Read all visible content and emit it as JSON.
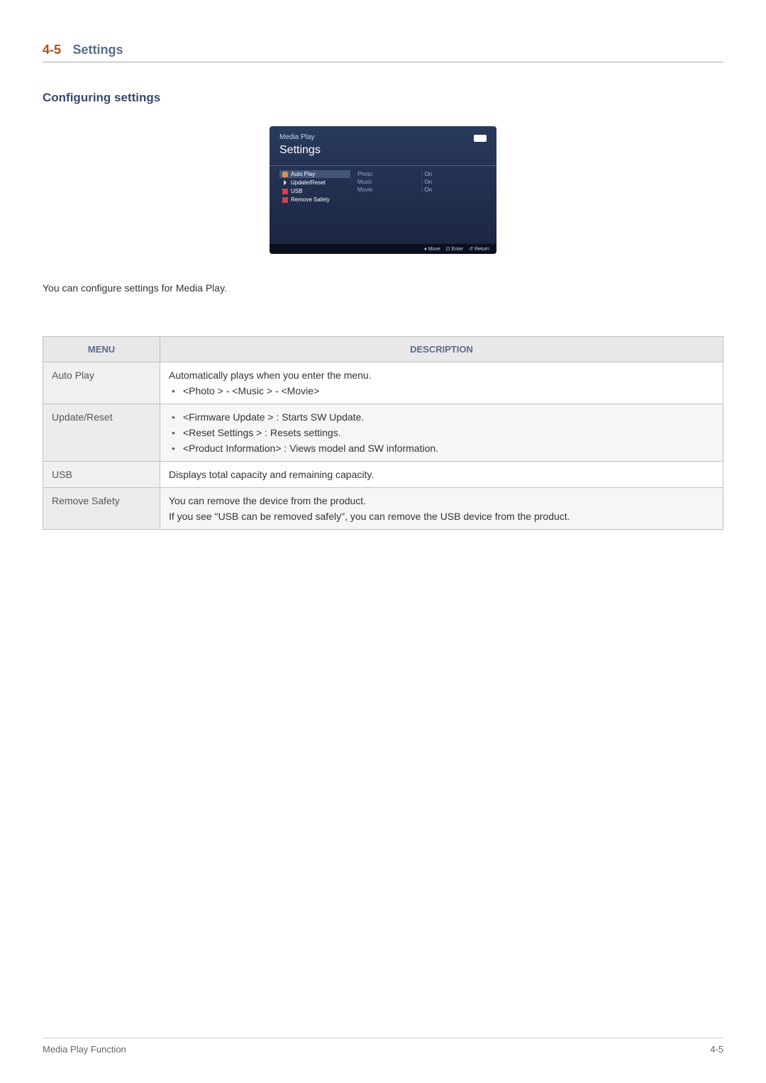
{
  "section": {
    "number": "4-5",
    "title": "Settings"
  },
  "subsection": {
    "title": "Configuring settings"
  },
  "osd": {
    "mediaplay_label": "Media Play",
    "settings_label": "Settings",
    "left_items": [
      {
        "label": "Auto Play",
        "highlighted": true
      },
      {
        "label": "Update/Reset",
        "highlighted": false
      },
      {
        "label": "USB",
        "highlighted": false
      },
      {
        "label": "Remove Safety",
        "highlighted": false
      }
    ],
    "middle_items": [
      "Photo",
      "Music",
      "Movie"
    ],
    "right_items": [
      ": On",
      ": On",
      ": On"
    ],
    "footer": {
      "move": "Move",
      "enter": "Enter",
      "return": "Return"
    }
  },
  "intro_text": "You can configure settings for Media Play.",
  "table": {
    "headers": {
      "menu": "MENU",
      "description": "DESCRIPTION"
    },
    "rows": [
      {
        "menu": "Auto Play",
        "desc_intro": "Automatically plays when you enter the menu.",
        "bullets": [
          "<Photo > - <Music > - <Movie>"
        ]
      },
      {
        "menu": "Update/Reset",
        "bullets": [
          "<Firmware Update > : Starts SW Update.",
          "<Reset Settings > : Resets settings.",
          "<Product Information> : Views model and SW information."
        ]
      },
      {
        "menu": "USB",
        "desc_intro": "Displays total capacity and remaining capacity."
      },
      {
        "menu": "Remove Safety",
        "desc_lines": [
          "You can remove the device from the product.",
          "If you see \"USB can be removed safely\", you can remove the USB device from the product."
        ]
      }
    ]
  },
  "footer": {
    "left": "Media Play Function",
    "right": "4-5"
  }
}
